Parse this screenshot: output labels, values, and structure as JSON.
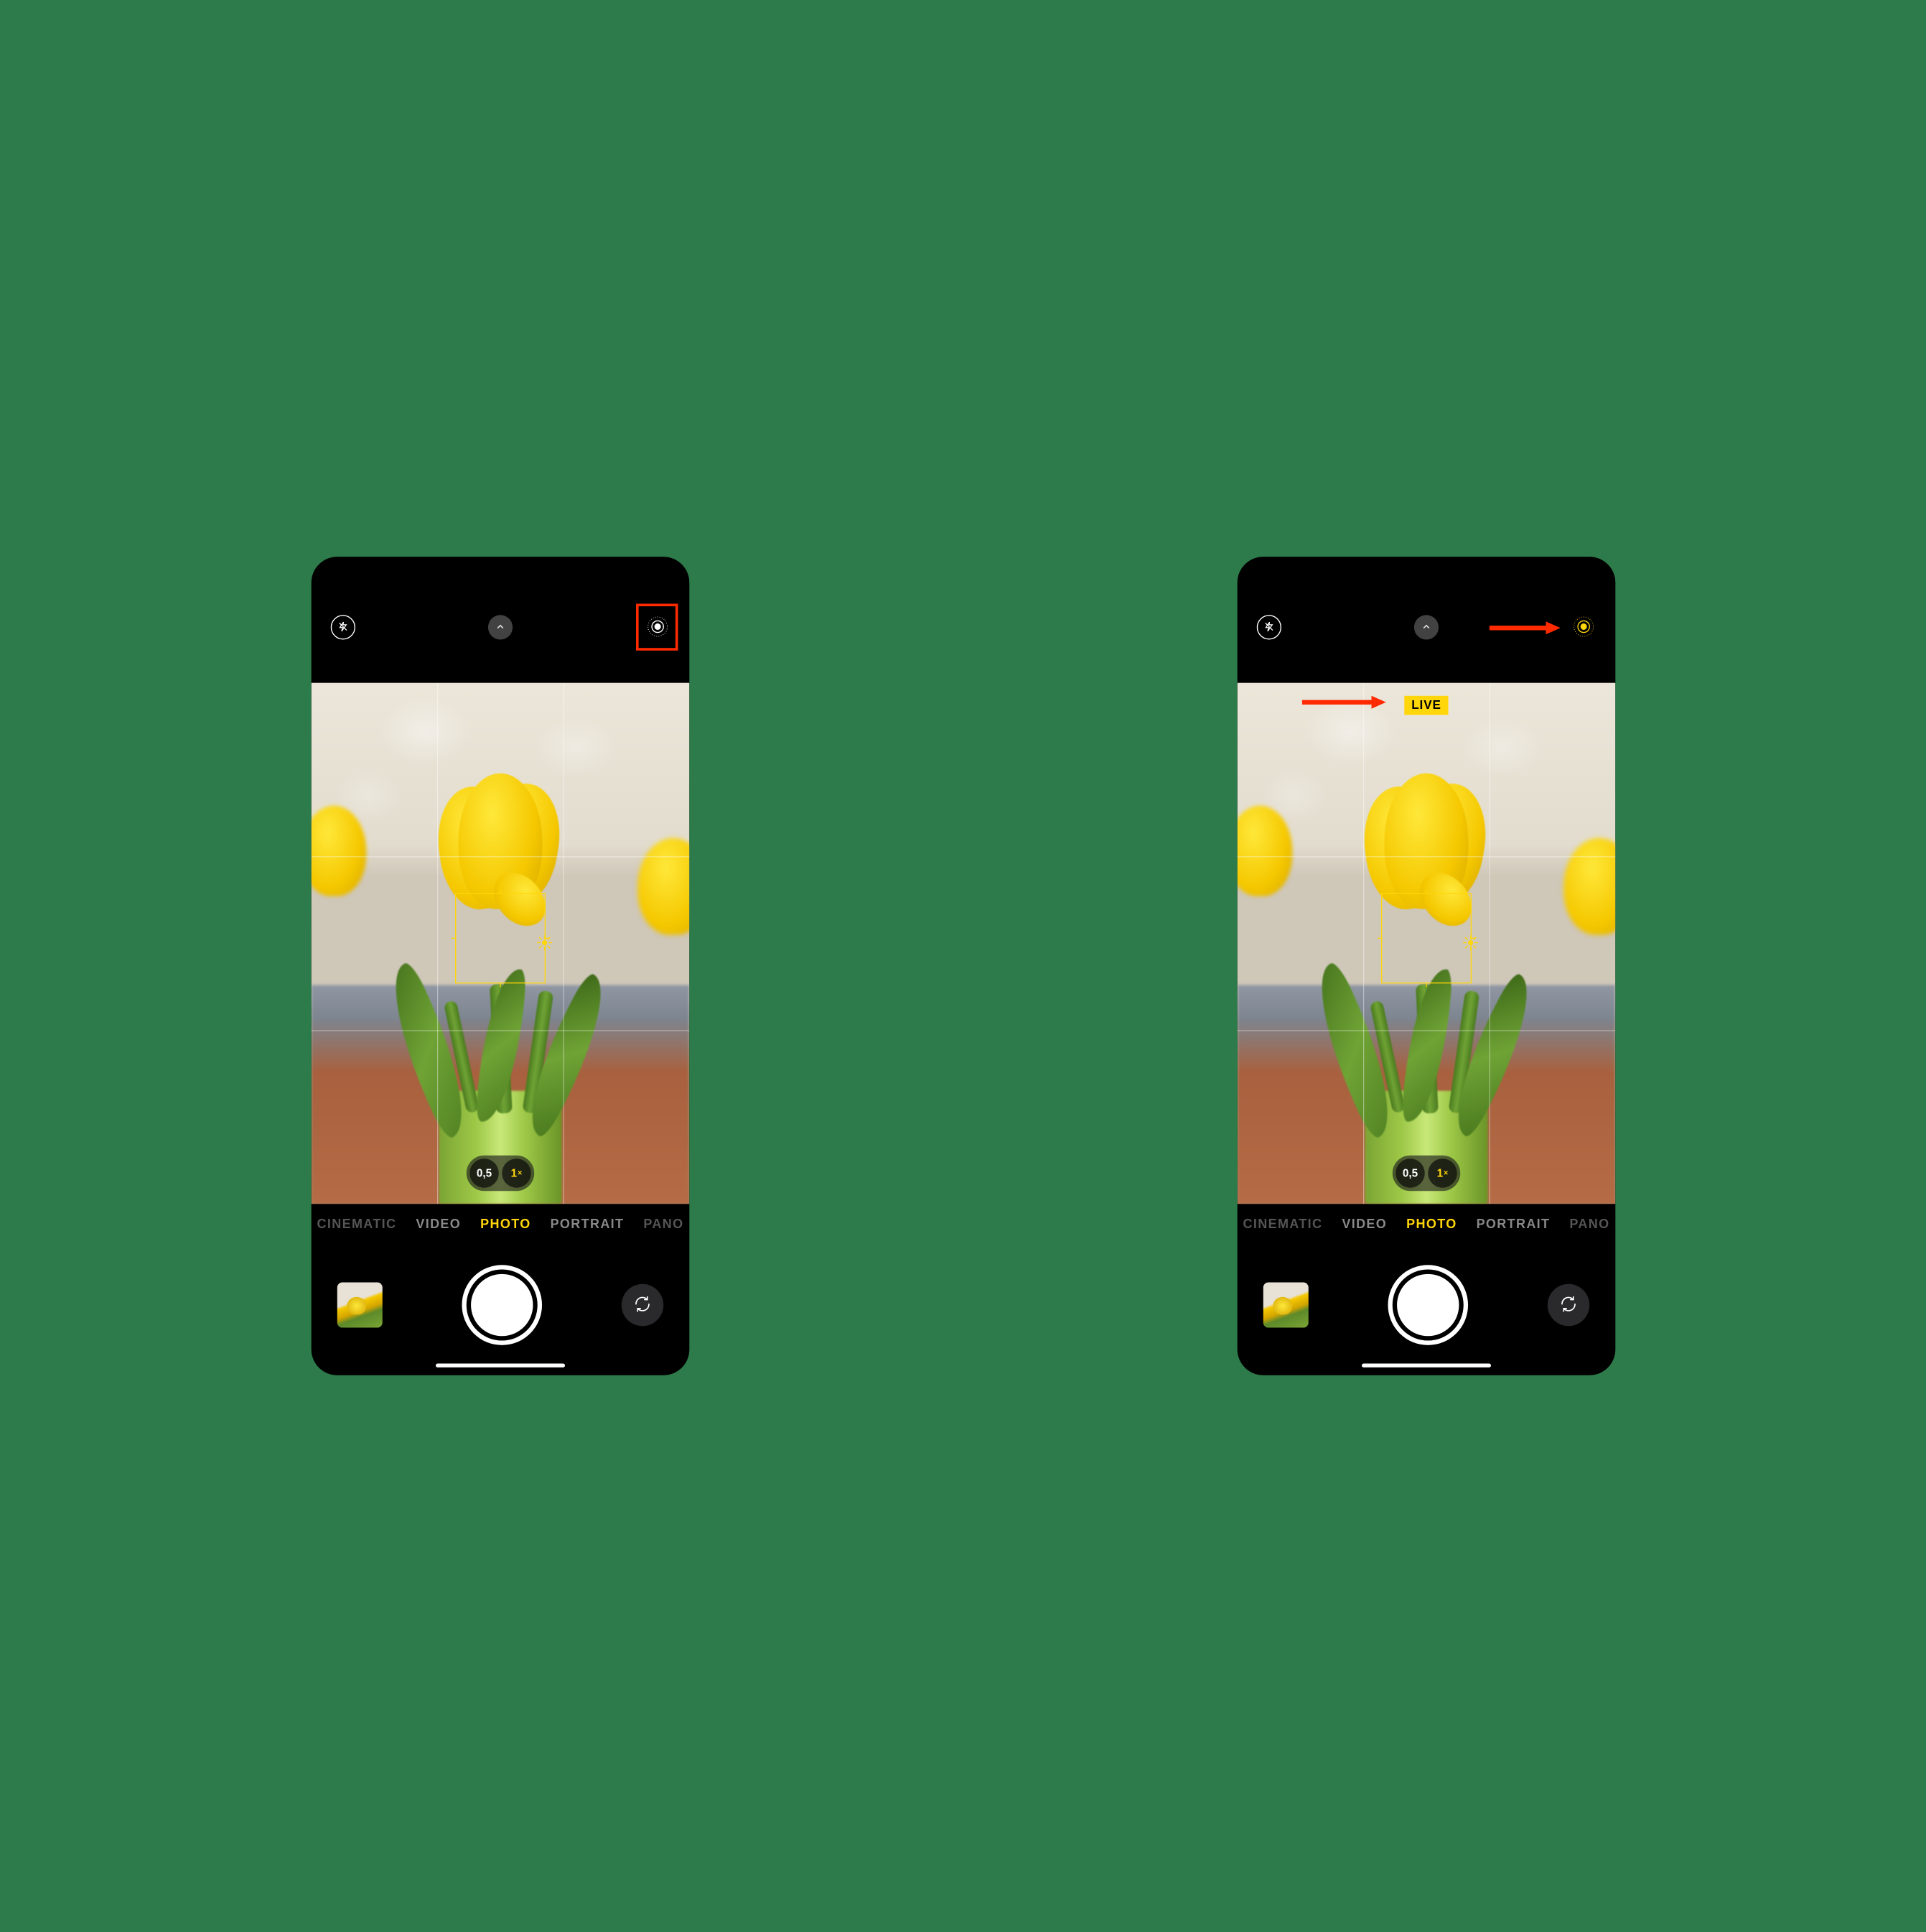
{
  "colors": {
    "accent": "#ffd60a",
    "highlight": "#ff2a00"
  },
  "left": {
    "live_active": false,
    "show_live_badge": false,
    "show_highlight_box": true,
    "show_top_arrow": false,
    "show_badge_arrow": false
  },
  "right": {
    "live_active": true,
    "show_live_badge": true,
    "live_badge_text": "LIVE",
    "show_highlight_box": false,
    "show_top_arrow": true,
    "show_badge_arrow": true
  },
  "zoom": {
    "options": [
      "0,5",
      "1"
    ],
    "active_index": 1,
    "suffix": "×"
  },
  "modes": {
    "items": [
      "CINEMATIC",
      "VIDEO",
      "PHOTO",
      "PORTRAIT",
      "PANO"
    ],
    "active_index": 2
  },
  "icons": {
    "flash": "flash-off-icon",
    "chevron": "chevron-up-icon",
    "live": "live-photo-icon",
    "flip": "camera-flip-icon",
    "exposure": "sun-icon"
  }
}
